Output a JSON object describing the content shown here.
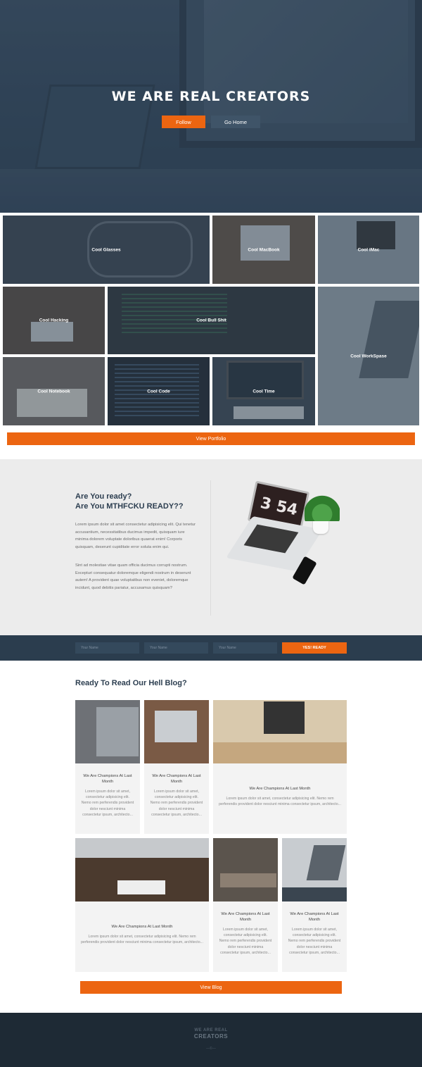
{
  "hero": {
    "title": "WE ARE REAL CREATORS",
    "follow_label": "Follow",
    "home_label": "Go Home"
  },
  "portfolio": {
    "tiles": [
      {
        "label": "Cool Glasses"
      },
      {
        "label": "Cool MacBook"
      },
      {
        "label": "Cool iMac"
      },
      {
        "label": "Cool Hacking"
      },
      {
        "label": "Cool Bull Shit"
      },
      {
        "label": "Cool WorkSpase"
      },
      {
        "label": "Cool Notebook"
      },
      {
        "label": "Cool Code"
      },
      {
        "label": "Cool Time"
      }
    ],
    "view_label": "View Portfolio"
  },
  "ready": {
    "heading_line1": "Are You ready?",
    "heading_line2": "Are You MTHFCKU READY??",
    "para1": "Lorem ipsum dolor sit amet consectetur adipisicing elit. Qui tenetur accusantium, necessitatibus ducimus impedit, quisquam iure minima dolorem voluptate doloribus quaerat enim! Corporis quisquam, deserunt cupiditate error soluta enim qui.",
    "para2": "Sint ad molestiae vitae quam officia ducimus corrupti nostrum. Excepturi consequatur doloremque eligendi nostrum in deserunt autem! A provident quae voluptatibus non eveniet, doloremque incidunt, quod debitis pariatur, accusamus quisquam?",
    "clock_digits": "3 54"
  },
  "form": {
    "placeholder1": "Your Name",
    "placeholder2": "Your Name",
    "placeholder3": "Your Name",
    "submit_label": "YES! READY"
  },
  "blog": {
    "title": "Ready To Read Our Hell Blog?",
    "cards": [
      {
        "title": "We Are Champions At Last Month",
        "text": "Lorem ipsum dolor sit amet, consectetur adipisicing elit. Nemo rem perferendis provident dolor nesciunt minima consectetur ipsum, architecto..."
      },
      {
        "title": "We Are Champions At Last Month",
        "text": "Lorem ipsum dolor sit amet, consectetur adipisicing elit. Nemo rem perferendis provident dolor nesciunt minima consectetur ipsum, architecto..."
      },
      {
        "title": "We Are Champions At Last Month",
        "text": "Lorem ipsum dolor sit amet, consectetur adipisicing elit. Nemo rem perferendis provident dolor nesciunt minima consectetur ipsum, architecto..."
      },
      {
        "title": "We Are Champions At Last Month",
        "text": "Lorem ipsum dolor sit amet, consectetur adipisicing elit. Nemo rem perferendis provident dolor nesciunt minima consectetur ipsum, architecto..."
      },
      {
        "title": "We Are Champions At Last Month",
        "text": "Lorem ipsum dolor sit amet, consectetur adipisicing elit. Nemo rem perferendis provident dolor nesciunt minima consectetur ipsum, architecto..."
      },
      {
        "title": "We Are Champions At Last Month",
        "text": "Lorem ipsum dolor sit amet, consectetur adipisicing elit. Nemo rem perferendis provident dolor nesciunt minima consectetur ipsum, architecto..."
      }
    ],
    "view_label": "View Blog"
  },
  "footer": {
    "logo_line1": "WE ARE REAL",
    "logo_line2": "CREATORS",
    "small": "—©—"
  },
  "colors": {
    "accent": "#ec6511",
    "navy": "#2c3e50",
    "footer": "#1e2a35"
  }
}
